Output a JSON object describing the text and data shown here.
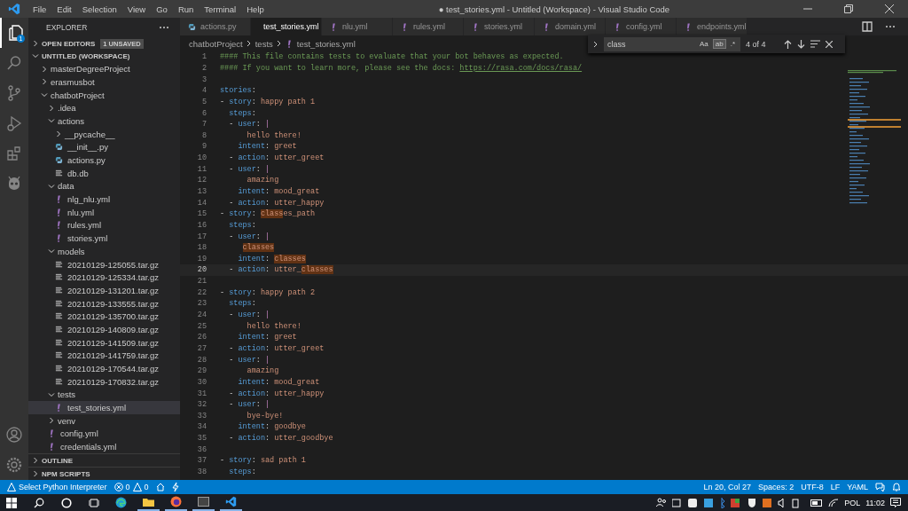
{
  "title_bar": {
    "menu": [
      "File",
      "Edit",
      "Selection",
      "View",
      "Go",
      "Run",
      "Terminal",
      "Help"
    ],
    "title": "● test_stories.yml - Untitled (Workspace) - Visual Studio Code"
  },
  "activity_bar": [
    {
      "kind": "files",
      "selected": true,
      "badge": "1"
    },
    {
      "kind": "search",
      "selected": false
    },
    {
      "kind": "source-control",
      "selected": false
    },
    {
      "kind": "run",
      "selected": false
    },
    {
      "kind": "extensions",
      "selected": false
    },
    {
      "kind": "robot",
      "selected": false
    }
  ],
  "activity_bottom": [
    {
      "kind": "account"
    },
    {
      "kind": "settings"
    }
  ],
  "sidebar": {
    "title": "EXPLORER",
    "open_editors": {
      "label": "OPEN EDITORS",
      "badge": "1 UNSAVED",
      "expanded": false
    },
    "workspace": {
      "label": "UNTITLED (WORKSPACE)",
      "expanded": true,
      "children": [
        {
          "label": "masterDegreeProject",
          "kind": "folder",
          "expanded": false,
          "selected": false
        },
        {
          "label": "erasmusbot",
          "kind": "folder",
          "expanded": false,
          "selected": false
        },
        {
          "label": "chatbotProject",
          "kind": "folder",
          "expanded": true,
          "selected": false,
          "children": [
            {
              "label": ".idea",
              "kind": "folder",
              "expanded": false,
              "selected": false
            },
            {
              "label": "actions",
              "kind": "folder",
              "expanded": true,
              "selected": false,
              "children": [
                {
                  "label": "__pycache__",
                  "kind": "folder",
                  "expanded": false,
                  "selected": false
                },
                {
                  "label": "__init__.py",
                  "kind": "python",
                  "selected": false
                },
                {
                  "label": "actions.py",
                  "kind": "python",
                  "selected": false
                },
                {
                  "label": "db.db",
                  "kind": "file",
                  "selected": false
                }
              ]
            },
            {
              "label": "data",
              "kind": "folder",
              "expanded": true,
              "selected": false,
              "children": [
                {
                  "label": "nlg_nlu.yml",
                  "kind": "yaml",
                  "selected": false
                },
                {
                  "label": "nlu.yml",
                  "kind": "yaml",
                  "selected": false
                },
                {
                  "label": "rules.yml",
                  "kind": "yaml",
                  "selected": false
                },
                {
                  "label": "stories.yml",
                  "kind": "yaml",
                  "selected": false
                }
              ]
            },
            {
              "label": "models",
              "kind": "folder",
              "expanded": true,
              "selected": false,
              "children": [
                {
                  "label": "20210129-125055.tar.gz",
                  "kind": "file",
                  "selected": false
                },
                {
                  "label": "20210129-125334.tar.gz",
                  "kind": "file",
                  "selected": false
                },
                {
                  "label": "20210129-131201.tar.gz",
                  "kind": "file",
                  "selected": false
                },
                {
                  "label": "20210129-133555.tar.gz",
                  "kind": "file",
                  "selected": false
                },
                {
                  "label": "20210129-135700.tar.gz",
                  "kind": "file",
                  "selected": false
                },
                {
                  "label": "20210129-140809.tar.gz",
                  "kind": "file",
                  "selected": false
                },
                {
                  "label": "20210129-141509.tar.gz",
                  "kind": "file",
                  "selected": false
                },
                {
                  "label": "20210129-141759.tar.gz",
                  "kind": "file",
                  "selected": false
                },
                {
                  "label": "20210129-170544.tar.gz",
                  "kind": "file",
                  "selected": false
                },
                {
                  "label": "20210129-170832.tar.gz",
                  "kind": "file",
                  "selected": false
                }
              ]
            },
            {
              "label": "tests",
              "kind": "folder",
              "expanded": true,
              "selected": false,
              "children": [
                {
                  "label": "test_stories.yml",
                  "kind": "yaml",
                  "selected": true
                }
              ]
            },
            {
              "label": "venv",
              "kind": "folder",
              "expanded": false,
              "selected": false
            },
            {
              "label": "config.yml",
              "kind": "yaml",
              "selected": false
            },
            {
              "label": "credentials.yml",
              "kind": "yaml",
              "selected": false
            }
          ]
        }
      ]
    },
    "bottom_sections": [
      {
        "label": "OUTLINE",
        "expanded": false
      },
      {
        "label": "NPM SCRIPTS",
        "expanded": false
      }
    ]
  },
  "tabs": [
    {
      "label": "actions.py",
      "kind": "python",
      "selected": false,
      "dirty": false
    },
    {
      "label": "test_stories.yml",
      "kind": "yaml",
      "selected": true,
      "dirty": true
    },
    {
      "label": "nlu.yml",
      "kind": "yaml",
      "selected": false,
      "dirty": false
    },
    {
      "label": "rules.yml",
      "kind": "yaml",
      "selected": false,
      "dirty": false
    },
    {
      "label": "stories.yml",
      "kind": "yaml",
      "selected": false,
      "dirty": false
    },
    {
      "label": "domain.yml",
      "kind": "yaml",
      "selected": false,
      "dirty": false
    },
    {
      "label": "config.yml",
      "kind": "yaml",
      "selected": false,
      "dirty": false
    },
    {
      "label": "endpoints.yml",
      "kind": "yaml",
      "selected": false,
      "dirty": false
    }
  ],
  "breadcrumbs": [
    {
      "label": "chatbotProject",
      "kind": "folder"
    },
    {
      "label": "tests",
      "kind": "folder"
    },
    {
      "label": "test_stories.yml",
      "kind": "yaml"
    }
  ],
  "find_widget": {
    "value": "class",
    "options": [
      {
        "label": "Aa",
        "selected": false
      },
      {
        "label": "ab",
        "selected": true
      },
      {
        "label": ".*",
        "selected": false
      }
    ],
    "count": "4 of 4"
  },
  "code_lines": [
    {
      "n": "1",
      "current": false,
      "tokens": [
        {
          "kind": "comment",
          "text": "#### This file contains tests to evaluate that your bot behaves as expected."
        }
      ]
    },
    {
      "n": "2",
      "current": false,
      "tokens": [
        {
          "kind": "comment",
          "text": "#### If you want to learn more, please see the docs:"
        },
        {
          "kind": "link",
          "text": " https://rasa.com/docs/rasa/"
        }
      ]
    },
    {
      "n": "3",
      "current": false
    },
    {
      "n": "4",
      "current": false,
      "tokens": [
        {
          "kind": "key",
          "text": "stories"
        },
        {
          "kind": "punct",
          "text": ":"
        }
      ]
    },
    {
      "n": "5",
      "current": false,
      "tokens": [
        {
          "kind": "punct",
          "text": "- "
        },
        {
          "kind": "key",
          "text": "story"
        },
        {
          "kind": "punct",
          "text": ": "
        },
        {
          "kind": "value",
          "text": "happy path 1"
        }
      ]
    },
    {
      "n": "6",
      "current": false,
      "tokens": [
        {
          "kind": "key",
          "text": "  steps"
        },
        {
          "kind": "punct",
          "text": ":"
        }
      ]
    },
    {
      "n": "7",
      "current": false,
      "tokens": [
        {
          "kind": "punct",
          "text": "  - "
        },
        {
          "kind": "key",
          "text": "user"
        },
        {
          "kind": "punct",
          "text": ": "
        },
        {
          "kind": "bar",
          "text": "|"
        }
      ]
    },
    {
      "n": "8",
      "current": false,
      "tokens": [
        {
          "kind": "value",
          "text": "      hello there!"
        }
      ]
    },
    {
      "n": "9",
      "current": false,
      "tokens": [
        {
          "kind": "key",
          "text": "    intent"
        },
        {
          "kind": "punct",
          "text": ": "
        },
        {
          "kind": "value",
          "text": "greet"
        }
      ]
    },
    {
      "n": "10",
      "current": false,
      "tokens": [
        {
          "kind": "punct",
          "text": "  - "
        },
        {
          "kind": "key",
          "text": "action"
        },
        {
          "kind": "punct",
          "text": ": "
        },
        {
          "kind": "value",
          "text": "utter_greet"
        }
      ]
    },
    {
      "n": "11",
      "current": false,
      "tokens": [
        {
          "kind": "punct",
          "text": "  - "
        },
        {
          "kind": "key",
          "text": "user"
        },
        {
          "kind": "punct",
          "text": ": "
        },
        {
          "kind": "bar",
          "text": "|"
        }
      ]
    },
    {
      "n": "12",
      "current": false,
      "tokens": [
        {
          "kind": "value",
          "text": "      amazing"
        }
      ]
    },
    {
      "n": "13",
      "current": false,
      "tokens": [
        {
          "kind": "key",
          "text": "    intent"
        },
        {
          "kind": "punct",
          "text": ": "
        },
        {
          "kind": "value",
          "text": "mood_great"
        }
      ]
    },
    {
      "n": "14",
      "current": false,
      "tokens": [
        {
          "kind": "punct",
          "text": "  - "
        },
        {
          "kind": "key",
          "text": "action"
        },
        {
          "kind": "punct",
          "text": ": "
        },
        {
          "kind": "value",
          "text": "utter_happy"
        }
      ]
    },
    {
      "n": "15",
      "current": false,
      "tokens": [
        {
          "kind": "punct",
          "text": "- "
        },
        {
          "kind": "key",
          "text": "story"
        },
        {
          "kind": "punct",
          "text": ": "
        },
        {
          "kind": "match",
          "text": "class"
        },
        {
          "kind": "value",
          "text": "es_path"
        }
      ]
    },
    {
      "n": "16",
      "current": false,
      "tokens": [
        {
          "kind": "key",
          "text": "  steps"
        },
        {
          "kind": "punct",
          "text": ":"
        }
      ]
    },
    {
      "n": "17",
      "current": false,
      "tokens": [
        {
          "kind": "punct",
          "text": "  - "
        },
        {
          "kind": "key",
          "text": "user"
        },
        {
          "kind": "punct",
          "text": ": "
        },
        {
          "kind": "bar",
          "text": "|"
        }
      ]
    },
    {
      "n": "18",
      "current": false,
      "tokens": [
        {
          "kind": "match",
          "text": "     classes"
        }
      ]
    },
    {
      "n": "19",
      "current": false,
      "tokens": [
        {
          "kind": "key",
          "text": "    intent"
        },
        {
          "kind": "punct",
          "text": ": "
        },
        {
          "kind": "match",
          "text": "classes"
        }
      ]
    },
    {
      "n": "20",
      "current": true,
      "tokens": [
        {
          "kind": "punct",
          "text": "  - "
        },
        {
          "kind": "key",
          "text": "action"
        },
        {
          "kind": "punct",
          "text": ": "
        },
        {
          "kind": "value",
          "text": "utter_"
        },
        {
          "kind": "match",
          "text": "classes"
        }
      ]
    },
    {
      "n": "21",
      "current": false
    },
    {
      "n": "22",
      "current": false,
      "tokens": [
        {
          "kind": "punct",
          "text": "- "
        },
        {
          "kind": "key",
          "text": "story"
        },
        {
          "kind": "punct",
          "text": ": "
        },
        {
          "kind": "value",
          "text": "happy path 2"
        }
      ]
    },
    {
      "n": "23",
      "current": false,
      "tokens": [
        {
          "kind": "key",
          "text": "  steps"
        },
        {
          "kind": "punct",
          "text": ":"
        }
      ]
    },
    {
      "n": "24",
      "current": false,
      "tokens": [
        {
          "kind": "punct",
          "text": "  - "
        },
        {
          "kind": "key",
          "text": "user"
        },
        {
          "kind": "punct",
          "text": ": "
        },
        {
          "kind": "bar",
          "text": "|"
        }
      ]
    },
    {
      "n": "25",
      "current": false,
      "tokens": [
        {
          "kind": "value",
          "text": "      hello there!"
        }
      ]
    },
    {
      "n": "26",
      "current": false,
      "tokens": [
        {
          "kind": "key",
          "text": "    intent"
        },
        {
          "kind": "punct",
          "text": ": "
        },
        {
          "kind": "value",
          "text": "greet"
        }
      ]
    },
    {
      "n": "27",
      "current": false,
      "tokens": [
        {
          "kind": "punct",
          "text": "  - "
        },
        {
          "kind": "key",
          "text": "action"
        },
        {
          "kind": "punct",
          "text": ": "
        },
        {
          "kind": "value",
          "text": "utter_greet"
        }
      ]
    },
    {
      "n": "28",
      "current": false,
      "tokens": [
        {
          "kind": "punct",
          "text": "  - "
        },
        {
          "kind": "key",
          "text": "user"
        },
        {
          "kind": "punct",
          "text": ": "
        },
        {
          "kind": "bar",
          "text": "|"
        }
      ]
    },
    {
      "n": "29",
      "current": false,
      "tokens": [
        {
          "kind": "value",
          "text": "      amazing"
        }
      ]
    },
    {
      "n": "30",
      "current": false,
      "tokens": [
        {
          "kind": "key",
          "text": "    intent"
        },
        {
          "kind": "punct",
          "text": ": "
        },
        {
          "kind": "value",
          "text": "mood_great"
        }
      ]
    },
    {
      "n": "31",
      "current": false,
      "tokens": [
        {
          "kind": "punct",
          "text": "  - "
        },
        {
          "kind": "key",
          "text": "action"
        },
        {
          "kind": "punct",
          "text": ": "
        },
        {
          "kind": "value",
          "text": "utter_happy"
        }
      ]
    },
    {
      "n": "32",
      "current": false,
      "tokens": [
        {
          "kind": "punct",
          "text": "  - "
        },
        {
          "kind": "key",
          "text": "user"
        },
        {
          "kind": "punct",
          "text": ": "
        },
        {
          "kind": "bar",
          "text": "|"
        }
      ]
    },
    {
      "n": "33",
      "current": false,
      "tokens": [
        {
          "kind": "value",
          "text": "      bye-bye!"
        }
      ]
    },
    {
      "n": "34",
      "current": false,
      "tokens": [
        {
          "kind": "key",
          "text": "    intent"
        },
        {
          "kind": "punct",
          "text": ": "
        },
        {
          "kind": "value",
          "text": "goodbye"
        }
      ]
    },
    {
      "n": "35",
      "current": false,
      "tokens": [
        {
          "kind": "punct",
          "text": "  - "
        },
        {
          "kind": "key",
          "text": "action"
        },
        {
          "kind": "punct",
          "text": ": "
        },
        {
          "kind": "value",
          "text": "utter_goodbye"
        }
      ]
    },
    {
      "n": "36",
      "current": false
    },
    {
      "n": "37",
      "current": false,
      "tokens": [
        {
          "kind": "punct",
          "text": "- "
        },
        {
          "kind": "key",
          "text": "story"
        },
        {
          "kind": "punct",
          "text": ": "
        },
        {
          "kind": "value",
          "text": "sad path 1"
        }
      ]
    },
    {
      "n": "38",
      "current": false,
      "tokens": [
        {
          "kind": "key",
          "text": "  steps"
        },
        {
          "kind": "punct",
          "text": ":"
        }
      ]
    }
  ],
  "status_bar": {
    "left": [
      {
        "kind": "warning",
        "text": "Select Python Interpreter"
      },
      {
        "kind": "errors",
        "text": "0"
      },
      {
        "kind": "warnings",
        "text": "0"
      },
      {
        "kind": "home"
      },
      {
        "kind": "bolt"
      }
    ],
    "right": [
      {
        "text": "Ln 20, Col 27"
      },
      {
        "text": "Spaces: 2"
      },
      {
        "text": "UTF-8"
      },
      {
        "text": "LF"
      },
      {
        "text": "YAML"
      },
      {
        "kind": "feedback"
      },
      {
        "kind": "bell"
      }
    ]
  },
  "taskbar": {
    "apps": [
      {
        "kind": "windows",
        "active": false
      },
      {
        "kind": "search",
        "active": false
      },
      {
        "kind": "cortana",
        "active": false
      },
      {
        "kind": "task-view",
        "active": false
      },
      {
        "kind": "edge",
        "active": false
      },
      {
        "kind": "explorer",
        "active": true
      },
      {
        "kind": "firefox",
        "active": true
      },
      {
        "kind": "terminal",
        "active": true
      },
      {
        "kind": "vscode",
        "active": true
      }
    ],
    "language": "POL",
    "time": "11:02"
  }
}
